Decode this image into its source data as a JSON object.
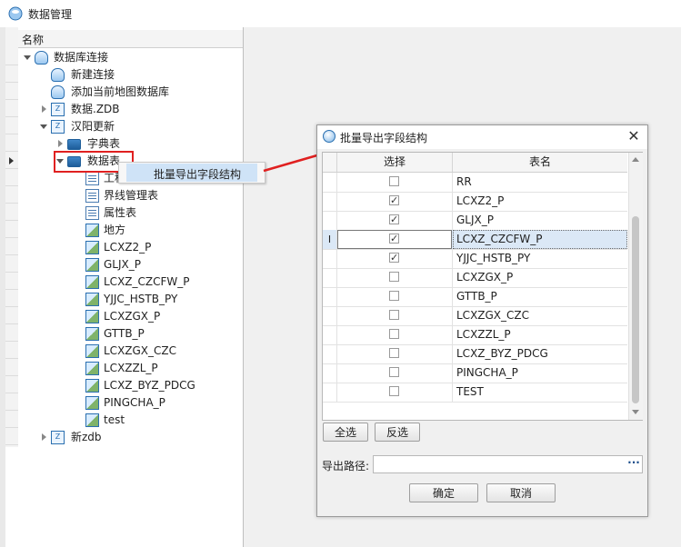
{
  "window": {
    "title": "数据管理"
  },
  "tree": {
    "header": "名称",
    "nodes": [
      {
        "label": "数据库连接",
        "icon": "database-icon"
      },
      {
        "label": "新建连接",
        "icon": "database-add-icon"
      },
      {
        "label": "添加当前地图数据库",
        "icon": "database-add-icon"
      },
      {
        "label": "数据.ZDB",
        "icon": "zdb-file-icon"
      },
      {
        "label": "汉阳更新",
        "icon": "zdb-file-icon"
      },
      {
        "label": "字典表",
        "icon": "folder-icon"
      },
      {
        "label": "数据表",
        "icon": "folder-icon"
      },
      {
        "label": "工程",
        "icon": "table-doc-icon"
      },
      {
        "label": "界线管理表",
        "icon": "table-doc-icon"
      },
      {
        "label": "属性表",
        "icon": "table-doc-icon"
      },
      {
        "label": "地方",
        "icon": "layer-icon"
      },
      {
        "label": "LCXZ2_P",
        "icon": "layer-icon"
      },
      {
        "label": "GLJX_P",
        "icon": "layer-icon"
      },
      {
        "label": "LCXZ_CZCFW_P",
        "icon": "layer-icon"
      },
      {
        "label": "YJJC_HSTB_PY",
        "icon": "layer-icon"
      },
      {
        "label": "LCXZGX_P",
        "icon": "layer-icon"
      },
      {
        "label": "GTTB_P",
        "icon": "layer-icon"
      },
      {
        "label": "LCXZGX_CZC",
        "icon": "layer-icon"
      },
      {
        "label": "LCXZZL_P",
        "icon": "layer-icon"
      },
      {
        "label": "LCXZ_BYZ_PDCG",
        "icon": "layer-icon"
      },
      {
        "label": "PINGCHA_P",
        "icon": "layer-icon"
      },
      {
        "label": "test",
        "icon": "layer-icon"
      },
      {
        "label": "新zdb",
        "icon": "zdb-file-icon"
      }
    ]
  },
  "context_menu": {
    "item": "批量导出字段结构"
  },
  "dialog": {
    "title": "批量导出字段结构",
    "close": "✕",
    "columns": [
      "选择",
      "表名"
    ],
    "rows": [
      {
        "name": "RR",
        "checked": false
      },
      {
        "name": "LCXZ2_P",
        "checked": true
      },
      {
        "name": "GLJX_P",
        "checked": true
      },
      {
        "name": "LCXZ_CZCFW_P",
        "checked": true,
        "selected": true,
        "gutter": "I"
      },
      {
        "name": "YJJC_HSTB_PY",
        "checked": true
      },
      {
        "name": "LCXZGX_P",
        "checked": false
      },
      {
        "name": "GTTB_P",
        "checked": false
      },
      {
        "name": "LCXZGX_CZC",
        "checked": false
      },
      {
        "name": "LCXZZL_P",
        "checked": false
      },
      {
        "name": "LCXZ_BYZ_PDCG",
        "checked": false
      },
      {
        "name": "PINGCHA_P",
        "checked": false
      },
      {
        "name": "TEST",
        "checked": false
      }
    ],
    "select_all": "全选",
    "invert": "反选",
    "path_label": "导出路径:",
    "path_value": "",
    "browse": "···",
    "ok": "确定",
    "cancel": "取消"
  },
  "colors": {
    "highlight": "#e02020",
    "accent": "#2a6fb0"
  }
}
